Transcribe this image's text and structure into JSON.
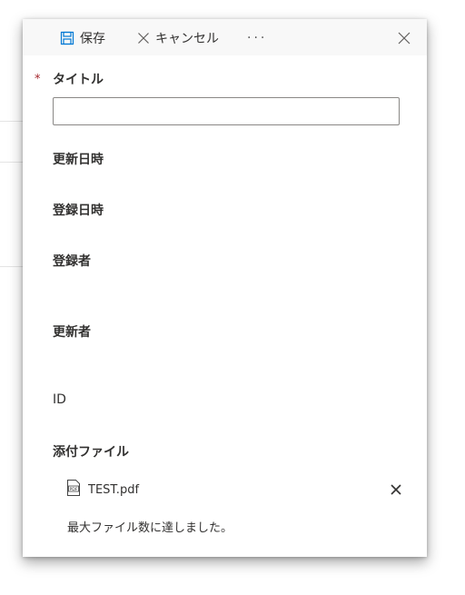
{
  "toolbar": {
    "save_label": "保存",
    "cancel_label": "キャンセル",
    "more_label": "···"
  },
  "form": {
    "required_marker": "*",
    "title_label": "タイトル",
    "title_value": "",
    "fields": {
      "modified": "更新日時",
      "created": "登録日時",
      "author": "登録者",
      "editor": "更新者",
      "id": "ID",
      "attachments": "添付ファイル"
    },
    "attachment": {
      "file_name": "TEST.pdf",
      "file_icon_text": "PDF"
    },
    "max_files_message": "最大ファイル数に達しました。"
  },
  "colors": {
    "accent": "#0078d4",
    "required": "#a4262c",
    "toolbar_bg": "#f8f8f8",
    "text": "#323130"
  }
}
